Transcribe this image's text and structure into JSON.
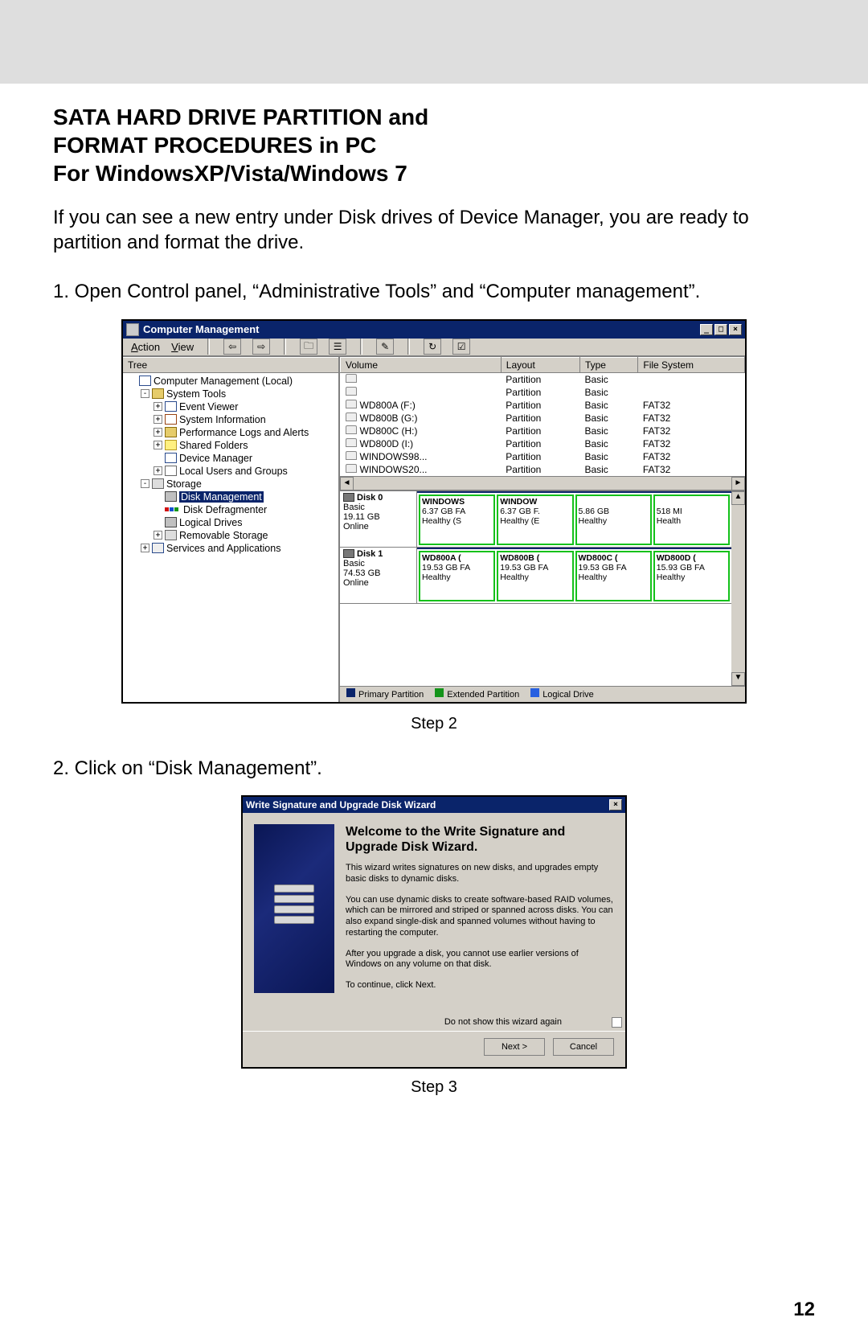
{
  "heading_line1": "SATA HARD DRIVE PARTITION and",
  "heading_line2": "FORMAT PROCEDURES in PC",
  "heading_line3": "For WindowsXP/Vista/Windows 7",
  "intro": "If you can see a new entry under Disk drives of Device Manager, you are ready to partition and format the drive.",
  "step1": "1.  Open Control panel, “Administrative Tools” and “Computer management”.",
  "caption1": "Step 2",
  "step2": "2.  Click on “Disk Management”.",
  "caption2": "Step 3",
  "page_number": "12",
  "cm": {
    "title": "Computer Management",
    "menus": {
      "action": "Action",
      "view": "View"
    },
    "tree_header": "Tree",
    "tree": {
      "root": "Computer Management (Local)",
      "system_tools": "System Tools",
      "event_viewer": "Event Viewer",
      "system_info": "System Information",
      "perf_logs": "Performance Logs and Alerts",
      "shared_folders": "Shared Folders",
      "device_manager": "Device Manager",
      "local_users": "Local Users and Groups",
      "storage": "Storage",
      "disk_management": "Disk Management",
      "disk_defrag": "Disk Defragmenter",
      "logical_drives": "Logical Drives",
      "removable_storage": "Removable Storage",
      "services_apps": "Services and Applications"
    },
    "columns": {
      "volume": "Volume",
      "layout": "Layout",
      "type": "Type",
      "fs": "File System"
    },
    "volumes": [
      {
        "name": "",
        "layout": "Partition",
        "type": "Basic",
        "fs": ""
      },
      {
        "name": "",
        "layout": "Partition",
        "type": "Basic",
        "fs": ""
      },
      {
        "name": "WD800A (F:)",
        "layout": "Partition",
        "type": "Basic",
        "fs": "FAT32"
      },
      {
        "name": "WD800B (G:)",
        "layout": "Partition",
        "type": "Basic",
        "fs": "FAT32"
      },
      {
        "name": "WD800C (H:)",
        "layout": "Partition",
        "type": "Basic",
        "fs": "FAT32"
      },
      {
        "name": "WD800D (I:)",
        "layout": "Partition",
        "type": "Basic",
        "fs": "FAT32"
      },
      {
        "name": "WINDOWS98...",
        "layout": "Partition",
        "type": "Basic",
        "fs": "FAT32"
      },
      {
        "name": "WINDOWS20...",
        "layout": "Partition",
        "type": "Basic",
        "fs": "FAT32"
      }
    ],
    "disks": [
      {
        "name": "Disk 0",
        "type": "Basic",
        "size": "19.11 GB",
        "status": "Online",
        "parts": [
          {
            "label": "WINDOWS",
            "size": "6.37 GB FA",
            "health": "Healthy (S"
          },
          {
            "label": "WINDOW",
            "size": "6.37 GB F.",
            "health": "Healthy (E"
          },
          {
            "label": "",
            "size": "5.86 GB",
            "health": "Healthy"
          },
          {
            "label": "",
            "size": "518 MI",
            "health": "Health"
          }
        ]
      },
      {
        "name": "Disk 1",
        "type": "Basic",
        "size": "74.53 GB",
        "status": "Online",
        "parts": [
          {
            "label": "WD800A (",
            "size": "19.53 GB FA",
            "health": "Healthy"
          },
          {
            "label": "WD800B (",
            "size": "19.53 GB FA",
            "health": "Healthy"
          },
          {
            "label": "WD800C (",
            "size": "19.53 GB FA",
            "health": "Healthy"
          },
          {
            "label": "WD800D (",
            "size": "15.93 GB FA",
            "health": "Healthy"
          }
        ]
      }
    ],
    "legend": {
      "primary": "Primary Partition",
      "extended": "Extended Partition",
      "logical": "Logical Drive"
    }
  },
  "wizard": {
    "title": "Write Signature and Upgrade Disk Wizard",
    "heading": "Welcome to the Write Signature and Upgrade Disk Wizard.",
    "p1": "This wizard writes signatures on new disks, and upgrades empty basic disks to dynamic disks.",
    "p2": "You can use dynamic disks to create software-based RAID volumes, which can be mirrored and striped or spanned across disks. You can also expand single-disk and spanned volumes without having to restarting the computer.",
    "p3": "After you upgrade a disk, you cannot use earlier versions of Windows on any volume on that disk.",
    "p4": "To continue, click Next.",
    "checkbox": "Do not show this wizard again",
    "next": "Next >",
    "cancel": "Cancel"
  }
}
